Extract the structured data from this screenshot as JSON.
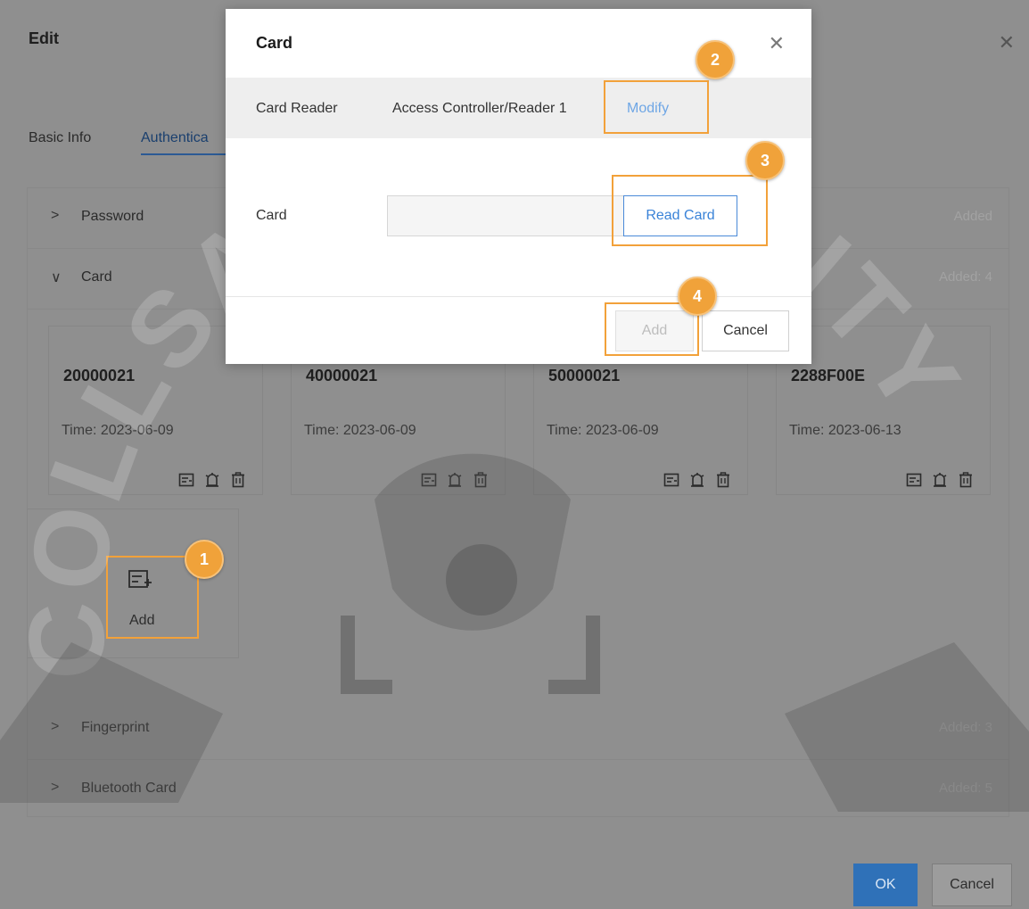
{
  "edit": {
    "title": "Edit",
    "tabs": [
      "Basic Info",
      "Authentica"
    ],
    "rows": {
      "password": {
        "label": "Password",
        "status": "Added"
      },
      "card": {
        "label": "Card",
        "status": "Added: 4"
      },
      "fingerprint": {
        "label": "Fingerprint",
        "status": "Added: 3"
      },
      "bluetooth": {
        "label": "Bluetooth Card",
        "status": "Added: 5"
      }
    },
    "cards": [
      {
        "id": "20000021",
        "time": "Time: 2023-06-09"
      },
      {
        "id": "40000021",
        "time": "Time: 2023-06-09"
      },
      {
        "id": "50000021",
        "time": "Time: 2023-06-09"
      },
      {
        "id": "2288F00E",
        "time": "Time: 2023-06-13"
      }
    ],
    "add_label": "Add",
    "ok_label": "OK",
    "cancel_label": "Cancel"
  },
  "modal": {
    "title": "Card",
    "reader_label": "Card Reader",
    "reader_value": "Access Controller/Reader 1",
    "modify_label": "Modify",
    "card_label": "Card",
    "card_value": "",
    "read_card_label": "Read Card",
    "add_label": "Add",
    "cancel_label": "Cancel"
  },
  "badges": [
    "1",
    "2",
    "3",
    "4"
  ],
  "watermark_text": "COLLSAM SECURITY",
  "colors": {
    "highlight": "#f2a13a",
    "primary": "#2f71b8",
    "link": "#6ea6e5"
  }
}
